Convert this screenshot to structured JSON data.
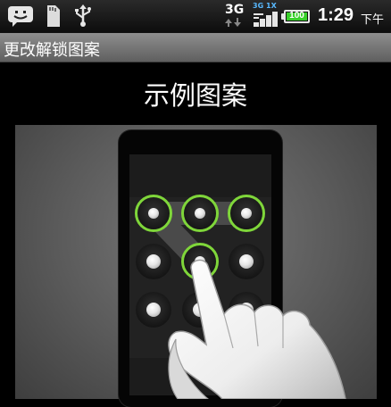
{
  "status_bar": {
    "icons": [
      "smiley-notification-icon",
      "sd-card-icon",
      "usb-icon",
      "3g-data-icon",
      "signal-icon",
      "battery-icon"
    ],
    "network_label": "3G",
    "signal_labels": [
      "3G",
      "1X"
    ],
    "battery_level": "100",
    "battery_color": "#39d12b",
    "time": "1:29",
    "ampm": "下午"
  },
  "title_bar": {
    "title": "更改解锁图案"
  },
  "main": {
    "heading": "示例图案",
    "pattern": {
      "grid_size": 3,
      "selected_dots": [
        0,
        1,
        2,
        4
      ],
      "highlight_color": "#7fd63a"
    },
    "hand_icon": "pointing-hand-icon"
  }
}
